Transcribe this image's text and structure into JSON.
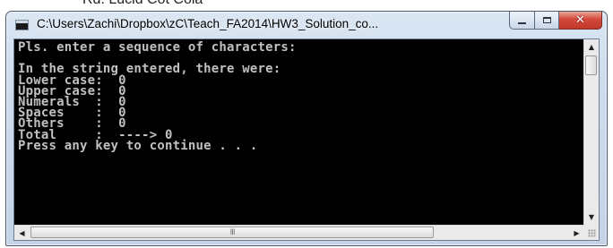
{
  "background": {
    "partial_text": "Rd. Lucid Cot Cola"
  },
  "window": {
    "title": "C:\\Users\\Zachi\\Dropbox\\zC\\Teach_FA2014\\HW3_Solution_co...",
    "buttons": {
      "minimize_icon": "minimize-icon",
      "maximize_icon": "maximize-icon",
      "close_icon": "close-icon"
    },
    "colors": {
      "console_bg": "#000000",
      "console_text": "#c0c0c0",
      "close_button": "#c7392c"
    }
  },
  "console": {
    "lines": [
      "Pls. enter a sequence of characters:",
      "",
      "In the string entered, there were:",
      "Lower case:  0",
      "Upper case:  0",
      "Numerals  :  0",
      "Spaces    :  0",
      "Others    :  0",
      "Total     :  ----> 0",
      "Press any key to continue . . ."
    ]
  },
  "scrollbars": {
    "grip_glyph": "III"
  }
}
